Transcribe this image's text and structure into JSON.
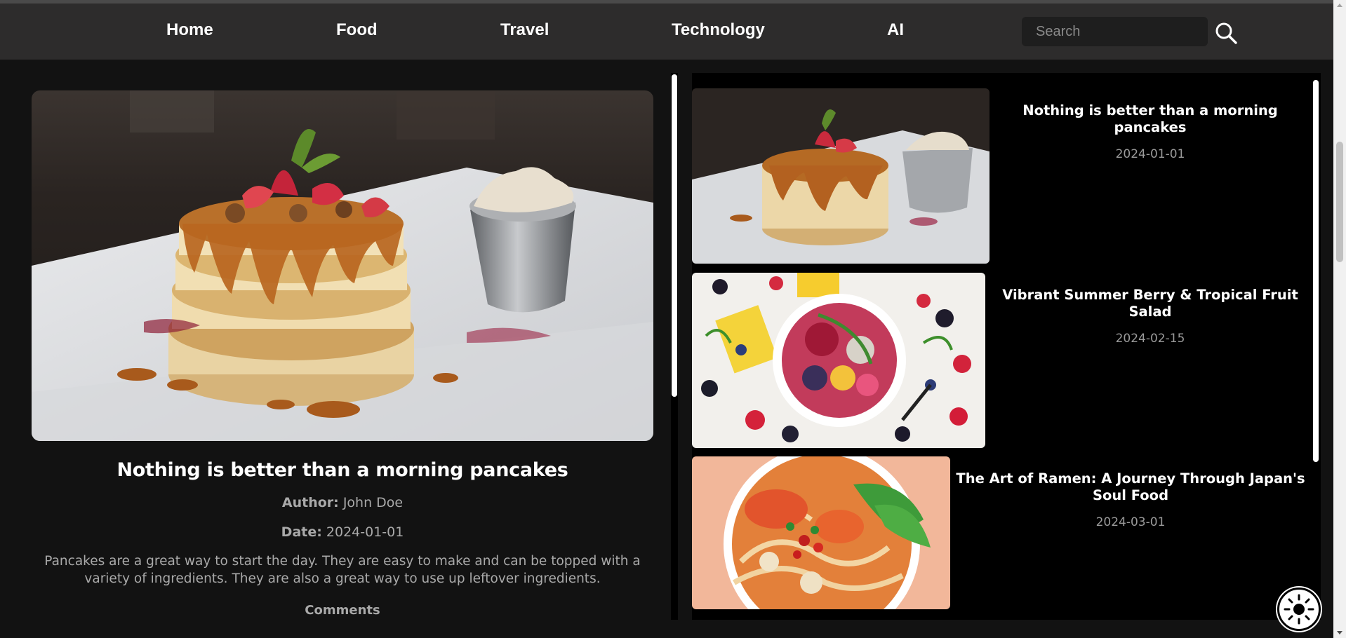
{
  "nav": {
    "links": [
      "Home",
      "Food",
      "Travel",
      "Technology",
      "AI"
    ],
    "search_placeholder": "Search"
  },
  "main_article": {
    "title": "Nothing is better than a morning pancakes",
    "author_label": "Author:",
    "author": "John Doe",
    "date_label": "Date:",
    "date": "2024-01-01",
    "body": "Pancakes are a great way to start the day. They are easy to make and can be topped with a variety of ingredients. They are also a great way to use up leftover ingredients.",
    "comments_heading": "Comments"
  },
  "sidebar": {
    "posts": [
      {
        "title": "Nothing is better than a morning pancakes",
        "date": "2024-01-01",
        "image": "pancakes-photo"
      },
      {
        "title": "Vibrant Summer Berry & Tropical Fruit Salad",
        "date": "2024-02-15",
        "image": "fruit-salad-photo"
      },
      {
        "title": "The Art of Ramen: A Journey Through Japan's Soul Food",
        "date": "2024-03-01",
        "image": "ramen-photo"
      }
    ]
  },
  "theme_toggle": {
    "icon": "sun-icon"
  },
  "colors": {
    "navbar": "#2d2c2c",
    "page_bg": "#121212",
    "sidebar_bg": "#000000",
    "text_primary": "#ffffff",
    "text_muted": "#a9a9a9"
  }
}
